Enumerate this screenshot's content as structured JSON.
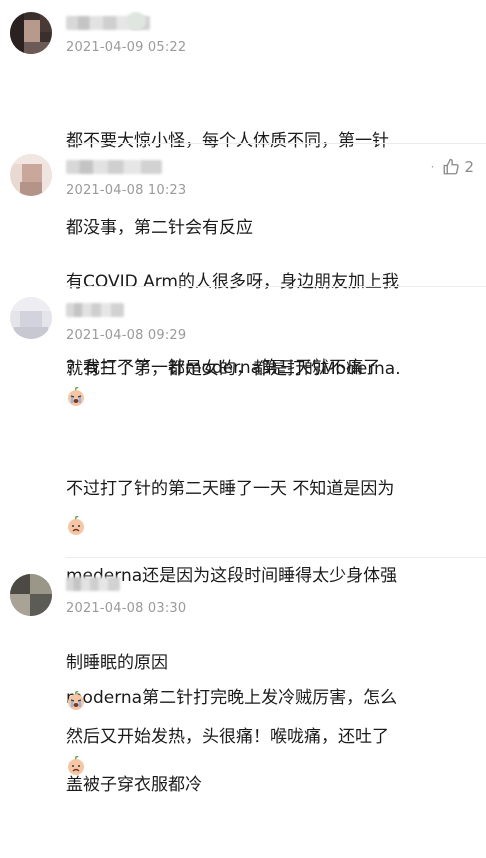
{
  "comments": [
    {
      "time": "2021-04-09 05:22",
      "lines": [
        "都不要大惊小怪，每个人体质不同，第一针",
        "都没事，第二针会有反应"
      ]
    },
    {
      "time": "2021-04-08 10:23",
      "likes": "2",
      "lines": [
        "有COVID Arm的人很多呀，身边朋友加上我",
        "就有三个了，都是女的，都是打的Moderna."
      ]
    },
    {
      "time": "2021-04-08 09:29",
      "line1": "？我打了第一针moderna第三天就不痛了",
      "lines2": [
        "不过打了针的第二天睡了一天 不知道是因为",
        "mederna还是因为这段时间睡得太少身体强",
        "制睡眠的原因"
      ]
    },
    {
      "time": "2021-04-08 03:30",
      "lines1": [
        "moderna第二针打完晚上发冷贼厉害，怎么",
        "盖被子穿衣服都冷"
      ],
      "line2": "然后又开始发热，头很痛！喉咙痛，还吐了"
    }
  ],
  "icons": {
    "like": "thumbs-up-icon",
    "crying": "crying-face-icon",
    "sad": "sad-face-icon"
  }
}
